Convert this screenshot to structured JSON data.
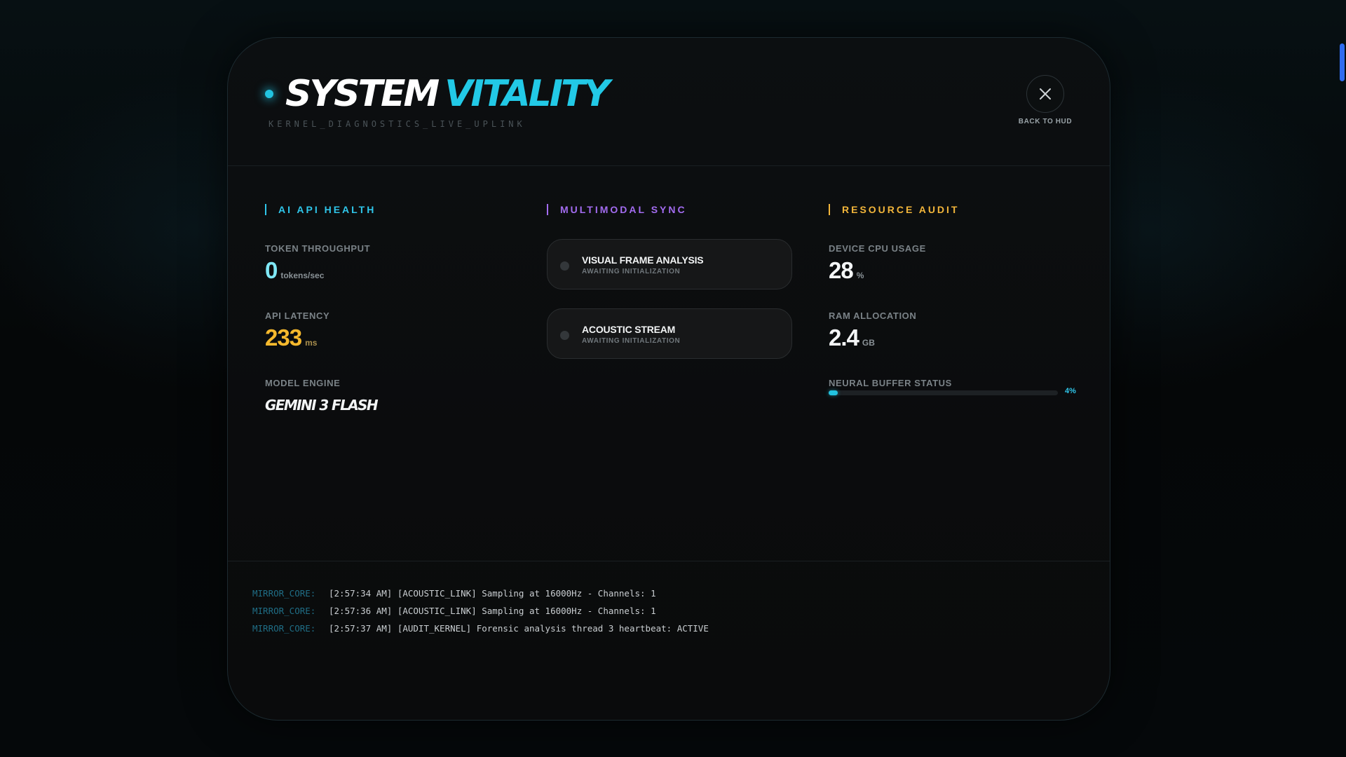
{
  "header": {
    "title_word1": "SYSTEM",
    "title_word2": "VITALITY",
    "subtitle": "KERNEL_DIAGNOSTICS_LIVE_UPLINK",
    "close_label": "BACK TO HUD"
  },
  "ai_health": {
    "heading": "AI API HEALTH",
    "throughput": {
      "label": "TOKEN THROUGHPUT",
      "value": "0",
      "unit": "tokens/sec"
    },
    "latency": {
      "label": "API LATENCY",
      "value": "233",
      "unit": "ms"
    },
    "engine": {
      "label": "MODEL ENGINE",
      "value": "GEMINI 3 FLASH"
    }
  },
  "multimodal": {
    "heading": "MULTIMODAL SYNC",
    "cards": [
      {
        "title": "VISUAL FRAME ANALYSIS",
        "status": "AWAITING INITIALIZATION"
      },
      {
        "title": "ACOUSTIC STREAM",
        "status": "AWAITING INITIALIZATION"
      }
    ]
  },
  "resource": {
    "heading": "RESOURCE AUDIT",
    "cpu": {
      "label": "DEVICE CPU USAGE",
      "value": "28",
      "unit": "%"
    },
    "ram": {
      "label": "RAM ALLOCATION",
      "value": "2.4",
      "unit": "GB"
    },
    "buffer": {
      "label": "NEURAL BUFFER STATUS",
      "percent": 4,
      "percent_label": "4%"
    }
  },
  "log": {
    "lines": [
      {
        "source": "MIRROR_CORE:",
        "message": "[2:57:34 AM] [ACOUSTIC_LINK] Sampling at 16000Hz - Channels: 1"
      },
      {
        "source": "MIRROR_CORE:",
        "message": "[2:57:36 AM] [ACOUSTIC_LINK] Sampling at 16000Hz - Channels: 1"
      },
      {
        "source": "MIRROR_CORE:",
        "message": "[2:57:37 AM] [AUDIT_KERNEL] Forensic analysis thread 3 heartbeat: ACTIVE"
      }
    ]
  },
  "colors": {
    "accent_cyan": "#22c9e6",
    "accent_purple": "#a36cf0",
    "accent_amber": "#f6b92d",
    "scrollbar": "#2f6cf0"
  }
}
